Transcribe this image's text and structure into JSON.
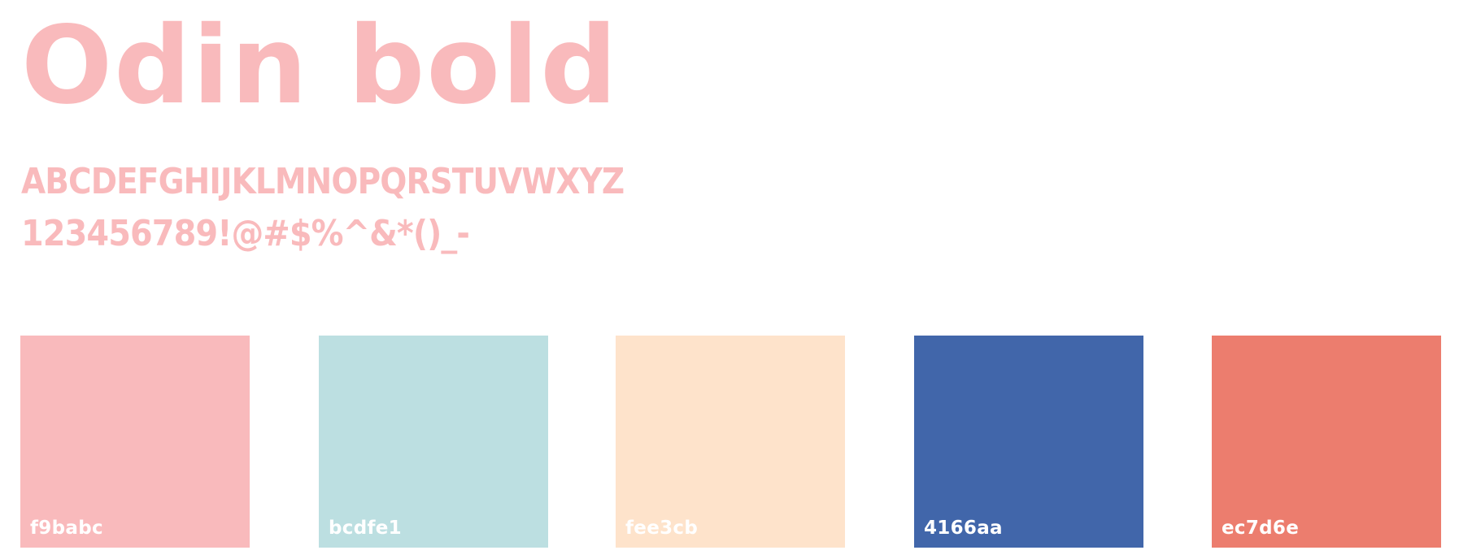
{
  "font_specimen": {
    "title": "Odin bold",
    "uppercase": "ABCDEFGHIJKLMNOPQRSTUVWXYZ",
    "numerals_symbols": "123456789!@#$%^&*()_-",
    "text_color": "#f9babc"
  },
  "palette": [
    {
      "hex": "f9babc",
      "color": "#f9babc"
    },
    {
      "hex": "bcdfe1",
      "color": "#bcdfe1"
    },
    {
      "hex": "fee3cb",
      "color": "#fee3cb"
    },
    {
      "hex": "4166aa",
      "color": "#4166aa"
    },
    {
      "hex": "ec7d6e",
      "color": "#ec7d6e"
    }
  ]
}
